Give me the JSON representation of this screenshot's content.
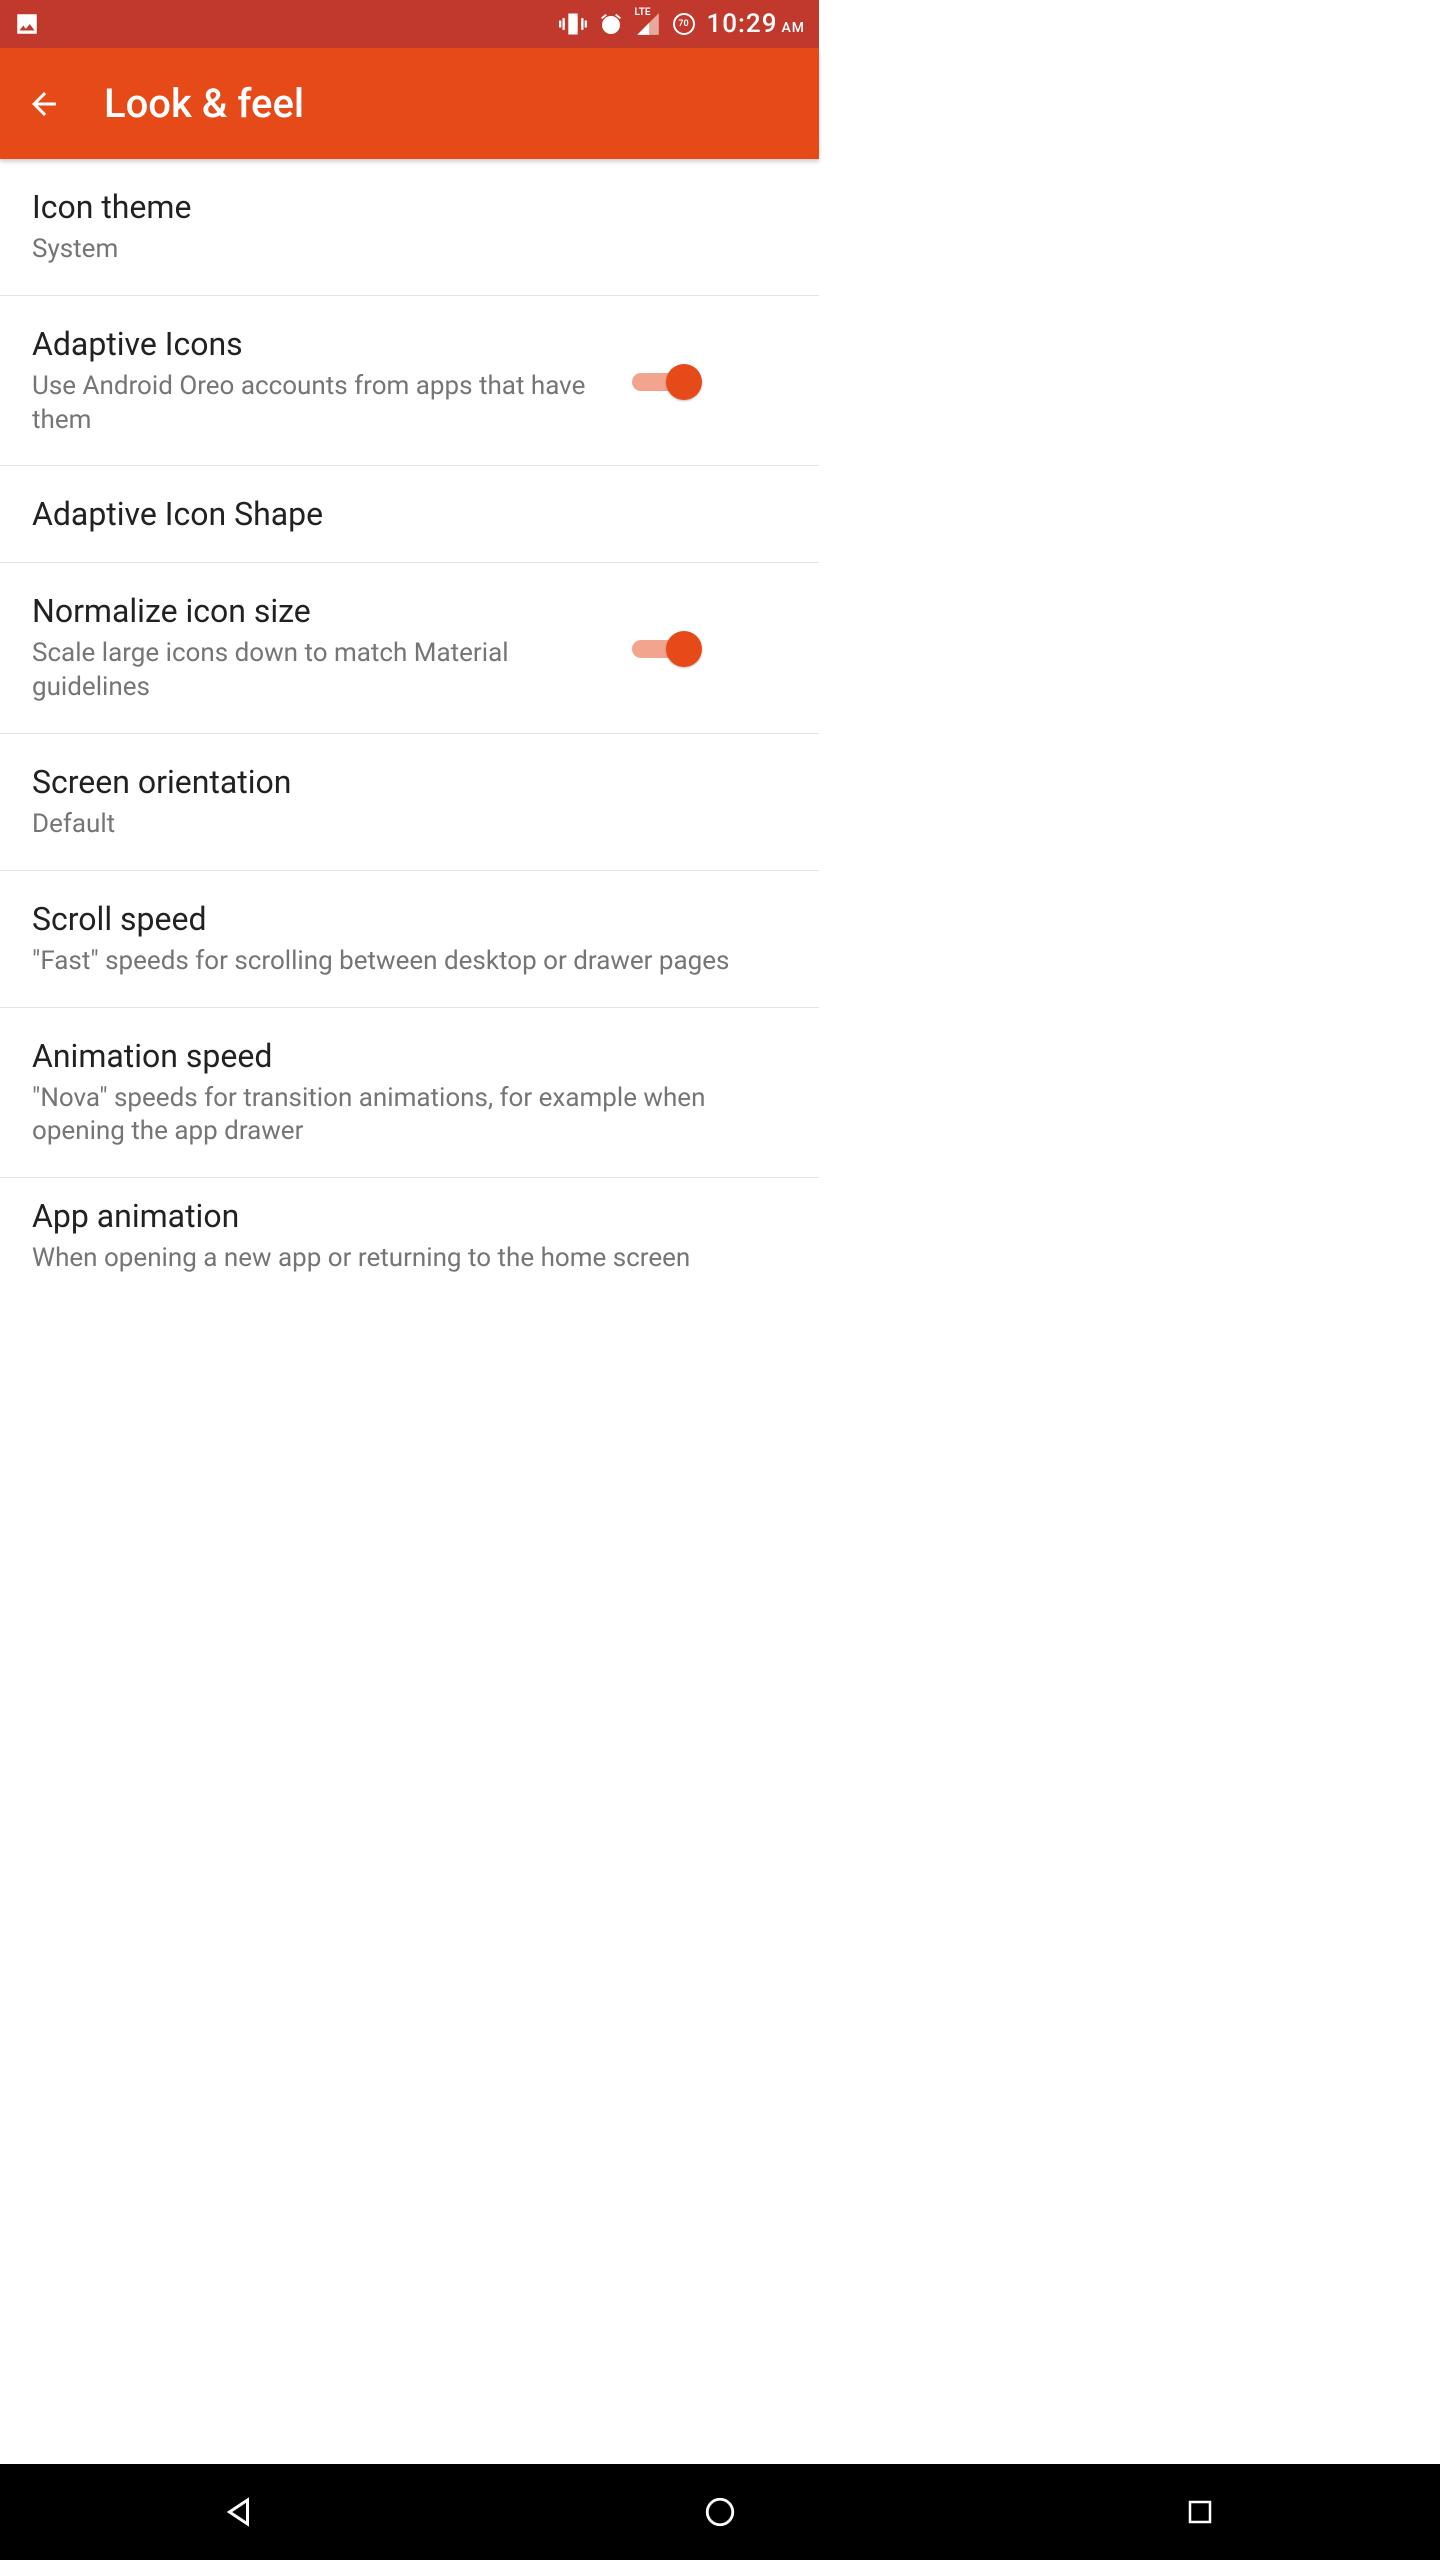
{
  "status": {
    "time": "10:29",
    "ampm": "AM",
    "network_label": "LTE",
    "battery_badge": "70"
  },
  "appbar": {
    "title": "Look & feel"
  },
  "settings": [
    {
      "title": "Icon theme",
      "subtitle": "System",
      "has_toggle": false
    },
    {
      "title": "Adaptive Icons",
      "subtitle": "Use Android Oreo accounts from apps that have them",
      "has_toggle": true,
      "toggle_on": true
    },
    {
      "title": "Adaptive Icon Shape",
      "subtitle": "",
      "has_toggle": false
    },
    {
      "title": "Normalize icon size",
      "subtitle": "Scale large icons down to match Material guidelines",
      "has_toggle": true,
      "toggle_on": true
    },
    {
      "title": "Screen orientation",
      "subtitle": "Default",
      "has_toggle": false
    },
    {
      "title": "Scroll speed",
      "subtitle": "\"Fast\" speeds for scrolling between desktop or drawer pages",
      "has_toggle": false
    },
    {
      "title": "Animation speed",
      "subtitle": "\"Nova\" speeds for transition animations, for example when opening the app drawer",
      "has_toggle": false
    },
    {
      "title": "App animation",
      "subtitle": "When opening a new app or returning to the home screen",
      "has_toggle": false
    }
  ],
  "colors": {
    "status_bar": "#c0392c",
    "app_bar": "#e64a19",
    "accent": "#e64a19",
    "text_primary": "#212121",
    "text_secondary": "#757575"
  }
}
